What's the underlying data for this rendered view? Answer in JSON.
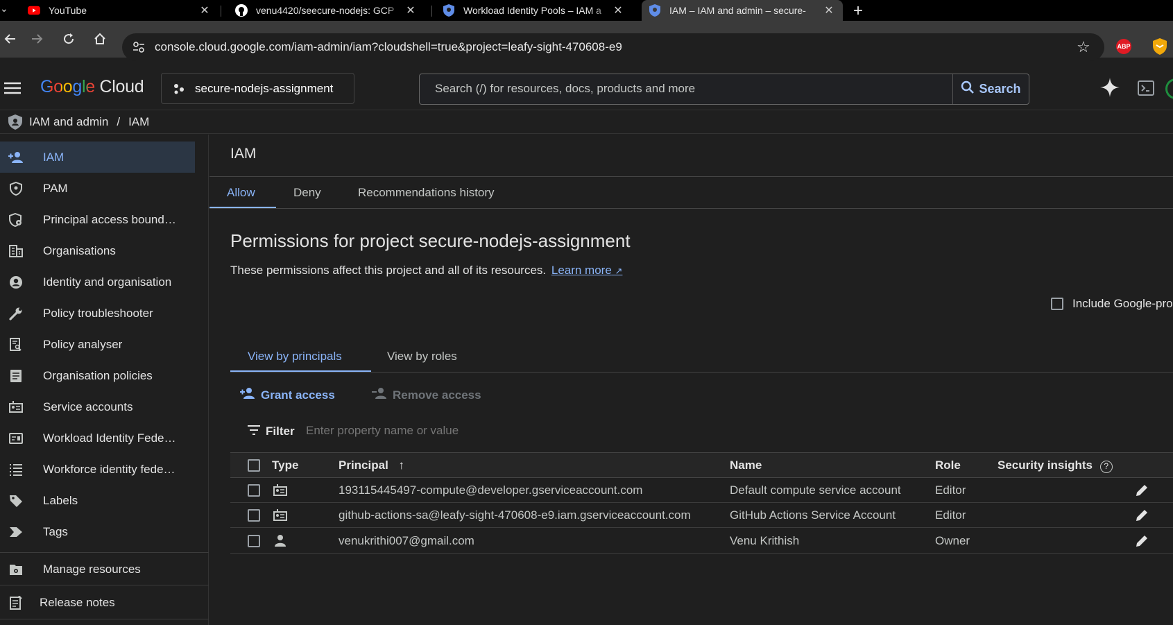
{
  "browser": {
    "tabs": [
      {
        "title": "YouTube",
        "favicon": "youtube-icon"
      },
      {
        "title": "venu4420/seecure-nodejs: GCP",
        "favicon": "github-icon"
      },
      {
        "title": "Workload Identity Pools – IAM a",
        "favicon": "gcp-shield-icon"
      },
      {
        "title": "IAM – IAM and admin – secure-",
        "favicon": "gcp-shield-icon",
        "active": true
      }
    ],
    "url": "console.cloud.google.com/iam-admin/iam?cloudshell=true&project=leafy-sight-470608-e9",
    "extensions": [
      "ABP",
      "shield-extension-icon"
    ]
  },
  "header": {
    "logo_google": "Google",
    "logo_cloud": "Cloud",
    "project": "secure-nodejs-assignment",
    "search_placeholder": "Search (/) for resources, docs, products and more",
    "search_button": "Search"
  },
  "breadcrumb": {
    "section": "IAM and admin",
    "separator": "/",
    "page": "IAM"
  },
  "sidebar": {
    "items": [
      {
        "label": "IAM",
        "icon": "person-add-icon",
        "active": true
      },
      {
        "label": "PAM",
        "icon": "shield-lock-icon"
      },
      {
        "label": "Principal access bound…",
        "icon": "shield-gear-icon"
      },
      {
        "label": "Organisations",
        "icon": "building-icon"
      },
      {
        "label": "Identity and organisation",
        "icon": "account-circle-icon"
      },
      {
        "label": "Policy troubleshooter",
        "icon": "wrench-icon"
      },
      {
        "label": "Policy analyser",
        "icon": "document-search-icon"
      },
      {
        "label": "Organisation policies",
        "icon": "document-list-icon"
      },
      {
        "label": "Service accounts",
        "icon": "service-account-icon"
      },
      {
        "label": "Workload Identity Fede…",
        "icon": "id-card-icon"
      },
      {
        "label": "Workforce identity fede…",
        "icon": "list-icon"
      },
      {
        "label": "Labels",
        "icon": "label-icon"
      },
      {
        "label": "Tags",
        "icon": "tag-chevron-icon"
      }
    ],
    "manage_resources": "Manage resources",
    "release_notes": "Release notes"
  },
  "main": {
    "title": "IAM",
    "tabs": [
      "Allow",
      "Deny",
      "Recommendations history"
    ],
    "heading": "Permissions for project secure-nodejs-assignment",
    "description": "These permissions affect this project and all of its resources.",
    "learn_more": "Learn more",
    "include_google": "Include Google-pro",
    "view_tabs": [
      "View by principals",
      "View by roles"
    ],
    "grant_access": "Grant access",
    "remove_access": "Remove access",
    "filter_label": "Filter",
    "filter_placeholder": "Enter property name or value",
    "columns": [
      "Type",
      "Principal",
      "Name",
      "Role",
      "Security insights"
    ],
    "rows": [
      {
        "type_icon": "service-account-icon",
        "principal": "193115445497-compute@developer.gserviceaccount.com",
        "name": "Default compute service account",
        "role": "Editor"
      },
      {
        "type_icon": "service-account-icon",
        "principal": "github-actions-sa@leafy-sight-470608-e9.iam.gserviceaccount.com",
        "name": "GitHub Actions Service Account",
        "role": "Editor"
      },
      {
        "type_icon": "person-icon",
        "principal": "venukrithi007@gmail.com",
        "name": "Venu Krithish",
        "role": "Owner"
      }
    ]
  },
  "colors": {
    "accent": "#8ab4f8",
    "background": "#1f1f1f",
    "active_nav_bg": "#2b3644"
  }
}
